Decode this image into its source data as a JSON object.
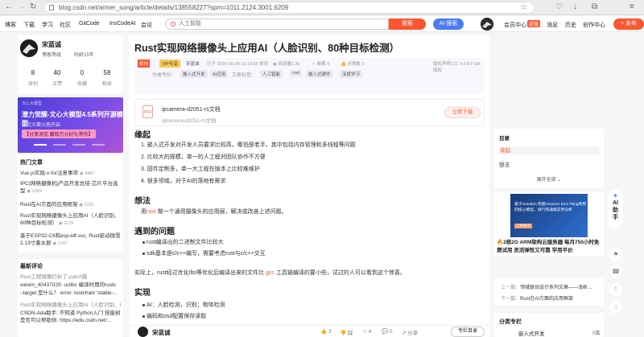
{
  "browser": {
    "url": "blog.csdn.net/armer_song/article/details/138558227?spm=1011.2124.3001.6209"
  },
  "topnav": {
    "items": [
      "博客",
      "下载",
      "学习",
      "社区",
      "GitCode",
      "InsCodeAI",
      "会议"
    ],
    "search_placeholder": "人工智能",
    "search_button": "搜索",
    "ai_button": "AI 搜索",
    "right_items": [
      "会员中心",
      "消息",
      "历史",
      "创作中心"
    ],
    "vip_badge": "超值",
    "publish_button": "发布"
  },
  "profile": {
    "name": "宋蓝诚",
    "level": "博客等级",
    "code_age": "码龄15年",
    "stats": [
      {
        "value": "8",
        "label": "原创"
      },
      {
        "value": "40",
        "label": "点赞"
      },
      {
        "value": "0",
        "label": "收藏"
      },
      {
        "value": "58",
        "label": "粉丝"
      }
    ]
  },
  "left_ad": {
    "brand": "文心大模型",
    "headline": "潜力觉醒-文心大模型4.5系列开源模型",
    "sub": "征文大赛火热开启",
    "cta": "【分享洞见 赢取万元好礼等你】"
  },
  "hot_articles": {
    "title": "热门文章",
    "items": [
      {
        "text": "Vue.js实践-v-for注意事项",
        "views": "4487"
      },
      {
        "text": "IPC(网络摄像机)产品开发总结-芯片平台选型",
        "views": "1369"
      },
      {
        "text": "Rust在AI方面的应用框架",
        "views": "1311"
      },
      {
        "text": "Rust实现网络摄像头上应用AI（人脸识别、80种目标检测）",
        "views": "1179"
      },
      {
        "text": "基于ESP32-C6和esp-idf-svc, Rust驱动微雪2.13寸墨水屏",
        "views": "1147"
      }
    ]
  },
  "comments": {
    "title": "最新评论",
    "items": [
      "Rust工程镜像打补丁-patch篇",
      "weixin_40437029: uclibc 编译时用的rustc",
      "–target 是什么？ error: toolchain 'stable-...",
      "Rust实现网络摄像头上应用AI（人脸识别、80...",
      "CSDN-Ada助手: 不知道 Python入门 技能树是否可以帮助你: https://edu.csdn.net/..."
    ]
  },
  "article": {
    "title": "Rust实现网络摄像头上应用AI（人脸识别、80种目标检测）",
    "original_tag": "原创",
    "vip_tag": "VIP专享",
    "author": "宋蓝诚",
    "time": "已于 2024-05-08 10:13:55 修改",
    "reads": "阅读量1.2k",
    "favs": "收藏 4",
    "likes": "点赞数 3",
    "license": "版权声明 CC 4.0 BY-SA版权",
    "column_label": "分类专栏：",
    "columns": [
      "嵌入式开发",
      "AI应用"
    ],
    "tags_label": "文章标签：",
    "tags": [
      "人工智能",
      "rust",
      "嵌入式硬件",
      "深度学习"
    ],
    "download": {
      "icon_text": "PDF",
      "name": "ipcamera-d2051-rs文档",
      "desc": "ipcamera-d2051-rs文档",
      "button": "立即下载"
    },
    "h_origin": "缘起",
    "origin_items": [
      "1. 嵌入式开发对开发人员要求比较高，哪怕是老手，其中包括内存管理和多线程等问题",
      "2. 比较大的规模，单一的人工程对团队协作不方便",
      "3. 固件定制多，单一大工程在版本上比较难维护",
      "4. 很多领域，对于AI的落地有需求"
    ],
    "h_idea": "想法",
    "idea_pre": "用",
    "idea_red": "rust",
    "idea_post": "做一个通用摄像头的应用层，解决或改善上述问题。",
    "h_problem": "遇到的问题",
    "problem_items": [
      "rust编译出的二进制文件比较大",
      "sdk基本是c/c++编写，需要考虑rust与c/c++交互"
    ],
    "practice_pre": "实际上，rust经过优化/lto等优化后编译出来的文件比",
    "practice_red": "gcc",
    "practice_post": "工具链编译的要小些，试过的人可以看到这个惊喜。",
    "h_impl": "实现",
    "impl_items": [
      "AI：人脸检测，识别；物体检测",
      "编码和osd配置保存读取"
    ],
    "bottom": {
      "author": "宋蓝诚",
      "likes": "3",
      "dislike": "踩",
      "favs": "4",
      "comments": "0",
      "share": "分享",
      "column_button": "专栏目录"
    }
  },
  "toc": {
    "title": "目录",
    "items": [
      "缘起",
      "想法"
    ],
    "expand": "展开全部"
  },
  "right_ad": {
    "text": "基于Graviton 构建Amazon EC2 Tiling所用的核心模型，进行高通级实时分析",
    "tag": "了解更多",
    "caption": "2核2G ARM架构云服务器 每月750小时免费试用 灵活弹性又可靠 学用平价"
  },
  "prevnext": {
    "prev_label": "上一篇：",
    "prev": "领域驱动设计系列文章——浅析...",
    "next_label": "下一篇：",
    "next": "Rust在AI方面的应用框架"
  },
  "category": {
    "title": "分类专栏",
    "item": "嵌入式开发",
    "count": "5篇"
  },
  "ai_float": {
    "label": "AI助手"
  }
}
